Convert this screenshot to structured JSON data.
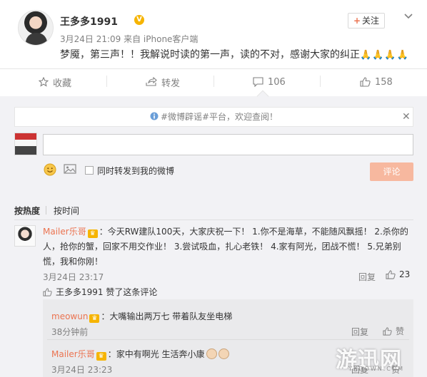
{
  "post": {
    "author": "王多多1991",
    "verified_badge": "V",
    "meta": "3月24日 21:09 来自 iPhone客户端",
    "follow_label": "关注",
    "text": "梦魇，第三声！！我解说时读的第一声，读的不对，感谢大家的纠正",
    "emoji_tail": "🙏🙏🙏🙏"
  },
  "actions": {
    "favorite": "收藏",
    "forward": "转发",
    "comment_count": "106",
    "like_count": "158"
  },
  "composer": {
    "notice": "#微博辟谣#平台，欢迎查阅！",
    "forward_label": "同时转发到我的微博",
    "submit_label": "评论"
  },
  "sort": {
    "hot": "按热度",
    "time": "按时间"
  },
  "comments": [
    {
      "user": "Mailer乐哥",
      "text": "：今天RW建队100天，大家庆祝一下！ 1.你不是海草，不能随风飘摇！ 2.杀你的人，抢你的蟹，回家不用交作业！ 3.尝试吸血，扎心老铁！ 4.家有阿光，团战不慌！ 5.兄弟别慌，我和你刚！",
      "time": "3月24日 23:17",
      "reply_label": "回复",
      "likes": "23",
      "liked_by": "王多多1991 赞了这条评论"
    }
  ],
  "replies": [
    {
      "user": "meowun",
      "text": "：大嘴输出两万七 带着队友坐电梯",
      "time": "38分钟前",
      "reply_label": "回复",
      "like_label": "赞"
    },
    {
      "user": "Mailer乐哥",
      "text": "：家中有啊光 生活奔小康",
      "time": "3月24日 23:23",
      "reply_label": "回复",
      "like_label": "赞"
    }
  ],
  "watermark": {
    "main": "游迅网",
    "sub": "YXDOWN.COM"
  },
  "colors": {
    "link": "#eb7350",
    "panel": "#f2f2f5",
    "submit": "#f7b89f",
    "badge": "#f6b400"
  }
}
